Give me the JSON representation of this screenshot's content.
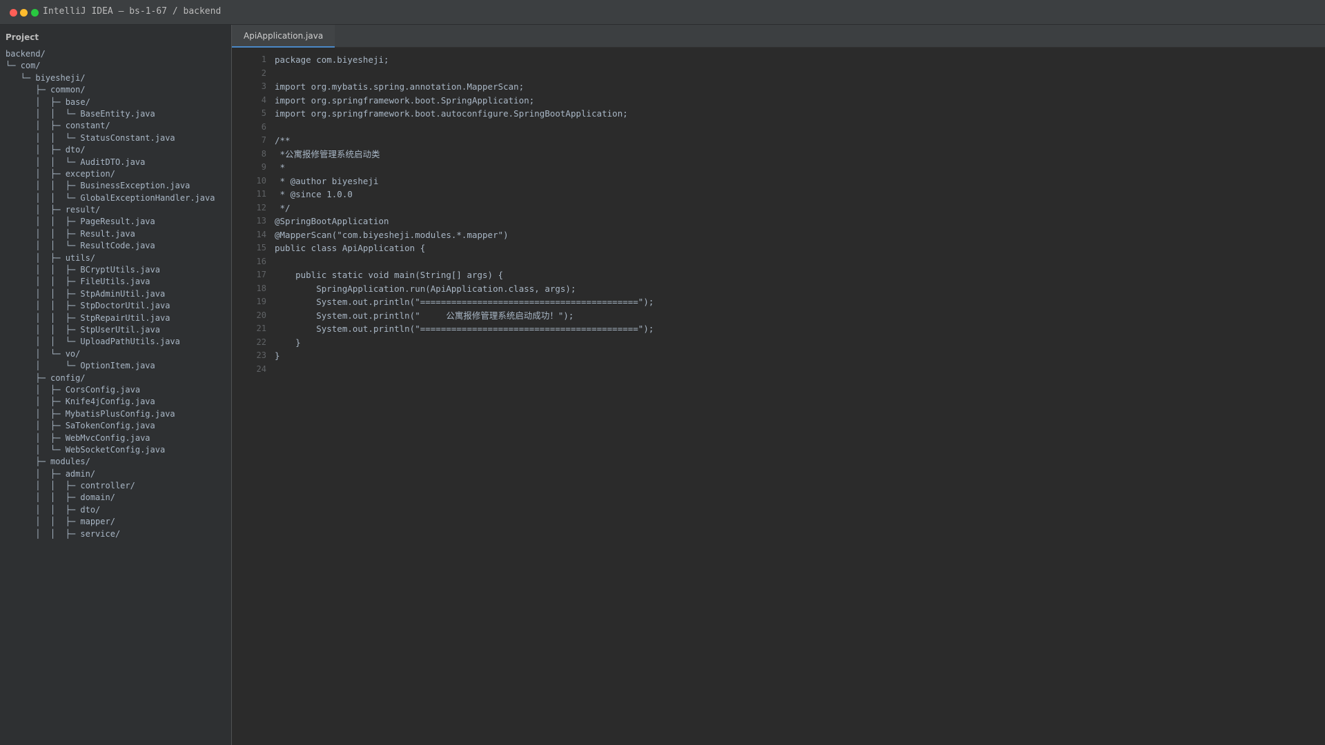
{
  "window": {
    "title": "IntelliJ IDEA — bs-1-67 / backend"
  },
  "sidebar": {
    "header": "Project",
    "tree": [
      {
        "prefix": "",
        "label": "backend/"
      },
      {
        "prefix": "└─ ",
        "label": "com/"
      },
      {
        "prefix": "   └─ ",
        "label": "biyesheji/"
      },
      {
        "prefix": "      ├─ ",
        "label": "common/"
      },
      {
        "prefix": "      │  ├─ ",
        "label": "base/"
      },
      {
        "prefix": "      │  │  └─ ",
        "label": "BaseEntity.java"
      },
      {
        "prefix": "      │  ├─ ",
        "label": "constant/"
      },
      {
        "prefix": "      │  │  └─ ",
        "label": "StatusConstant.java"
      },
      {
        "prefix": "      │  ├─ ",
        "label": "dto/"
      },
      {
        "prefix": "      │  │  └─ ",
        "label": "AuditDTO.java"
      },
      {
        "prefix": "      │  ├─ ",
        "label": "exception/"
      },
      {
        "prefix": "      │  │  ├─ ",
        "label": "BusinessException.java"
      },
      {
        "prefix": "      │  │  └─ ",
        "label": "GlobalExceptionHandler.java"
      },
      {
        "prefix": "      │  ├─ ",
        "label": "result/"
      },
      {
        "prefix": "      │  │  ├─ ",
        "label": "PageResult.java"
      },
      {
        "prefix": "      │  │  ├─ ",
        "label": "Result.java"
      },
      {
        "prefix": "      │  │  └─ ",
        "label": "ResultCode.java"
      },
      {
        "prefix": "      │  ├─ ",
        "label": "utils/"
      },
      {
        "prefix": "      │  │  ├─ ",
        "label": "BCryptUtils.java"
      },
      {
        "prefix": "      │  │  ├─ ",
        "label": "FileUtils.java"
      },
      {
        "prefix": "      │  │  ├─ ",
        "label": "StpAdminUtil.java"
      },
      {
        "prefix": "      │  │  ├─ ",
        "label": "StpDoctorUtil.java"
      },
      {
        "prefix": "      │  │  ├─ ",
        "label": "StpRepairUtil.java"
      },
      {
        "prefix": "      │  │  ├─ ",
        "label": "StpUserUtil.java"
      },
      {
        "prefix": "      │  │  └─ ",
        "label": "UploadPathUtils.java"
      },
      {
        "prefix": "      │  └─ ",
        "label": "vo/"
      },
      {
        "prefix": "      │     └─ ",
        "label": "OptionItem.java"
      },
      {
        "prefix": "      ├─ ",
        "label": "config/"
      },
      {
        "prefix": "      │  ├─ ",
        "label": "CorsConfig.java"
      },
      {
        "prefix": "      │  ├─ ",
        "label": "Knife4jConfig.java"
      },
      {
        "prefix": "      │  ├─ ",
        "label": "MybatisPlusConfig.java"
      },
      {
        "prefix": "      │  ├─ ",
        "label": "SaTokenConfig.java"
      },
      {
        "prefix": "      │  ├─ ",
        "label": "WebMvcConfig.java"
      },
      {
        "prefix": "      │  └─ ",
        "label": "WebSocketConfig.java"
      },
      {
        "prefix": "      ├─ ",
        "label": "modules/"
      },
      {
        "prefix": "      │  ├─ ",
        "label": "admin/"
      },
      {
        "prefix": "      │  │  ├─ ",
        "label": "controller/"
      },
      {
        "prefix": "      │  │  ├─ ",
        "label": "domain/"
      },
      {
        "prefix": "      │  │  ├─ ",
        "label": "dto/"
      },
      {
        "prefix": "      │  │  ├─ ",
        "label": "mapper/"
      },
      {
        "prefix": "      │  │  ├─ ",
        "label": "service/"
      }
    ]
  },
  "editor": {
    "tab_label": "ApiApplication.java",
    "lines": [
      {
        "n": "1",
        "text": "package com.biyesheji;"
      },
      {
        "n": "2",
        "text": ""
      },
      {
        "n": "3",
        "text": "import org.mybatis.spring.annotation.MapperScan;"
      },
      {
        "n": "4",
        "text": "import org.springframework.boot.SpringApplication;"
      },
      {
        "n": "5",
        "text": "import org.springframework.boot.autoconfigure.SpringBootApplication;"
      },
      {
        "n": "6",
        "text": ""
      },
      {
        "n": "7",
        "text": "/**"
      },
      {
        "n": "8",
        "text": " *公寓报修管理系统启动类"
      },
      {
        "n": "9",
        "text": " *"
      },
      {
        "n": "10",
        "text": " * @author biyesheji"
      },
      {
        "n": "11",
        "text": " * @since 1.0.0"
      },
      {
        "n": "12",
        "text": " */"
      },
      {
        "n": "13",
        "text": "@SpringBootApplication"
      },
      {
        "n": "14",
        "text": "@MapperScan(\"com.biyesheji.modules.*.mapper\")"
      },
      {
        "n": "15",
        "text": "public class ApiApplication {"
      },
      {
        "n": "16",
        "text": ""
      },
      {
        "n": "17",
        "text": "    public static void main(String[] args) {"
      },
      {
        "n": "18",
        "text": "        SpringApplication.run(ApiApplication.class, args);"
      },
      {
        "n": "19",
        "text": "        System.out.println(\"==========================================\");"
      },
      {
        "n": "20",
        "text": "        System.out.println(\"     公寓报修管理系统启动成功！\");"
      },
      {
        "n": "21",
        "text": "        System.out.println(\"==========================================\");"
      },
      {
        "n": "22",
        "text": "    }"
      },
      {
        "n": "23",
        "text": "}"
      },
      {
        "n": "24",
        "text": ""
      }
    ]
  }
}
